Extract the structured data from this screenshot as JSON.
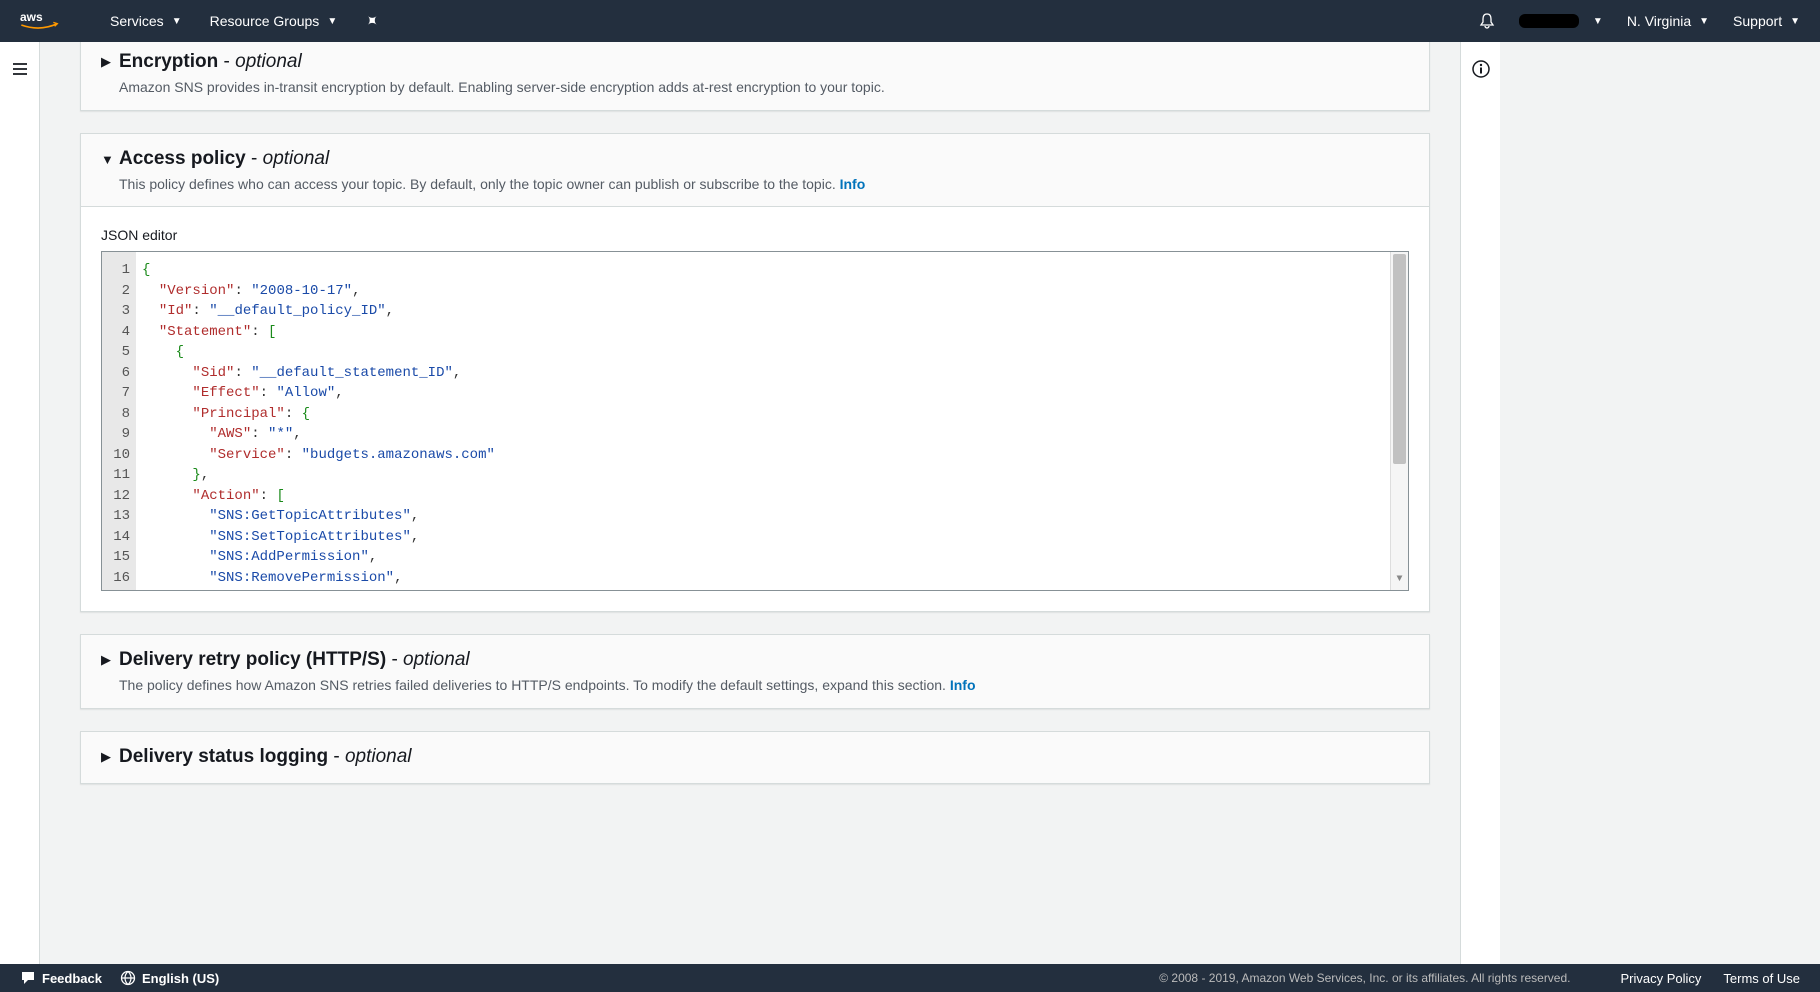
{
  "nav": {
    "services": "Services",
    "resource_groups": "Resource Groups",
    "region": "N. Virginia",
    "support": "Support"
  },
  "panels": {
    "encryption": {
      "title": "Encryption",
      "optional": "optional",
      "desc": "Amazon SNS provides in-transit encryption by default. Enabling server-side encryption adds at-rest encryption to your topic."
    },
    "access_policy": {
      "title": "Access policy",
      "optional": "optional",
      "desc_text": "This policy defines who can access your topic. By default, only the topic owner can publish or subscribe to the topic.",
      "info": "Info",
      "editor_label": "JSON editor"
    },
    "delivery_retry": {
      "title": "Delivery retry policy (HTTP/S)",
      "optional": "optional",
      "desc_text": "The policy defines how Amazon SNS retries failed deliveries to HTTP/S endpoints. To modify the default settings, expand this section.",
      "info": "Info"
    },
    "delivery_status": {
      "title": "Delivery status logging",
      "optional": "optional"
    }
  },
  "footer": {
    "feedback": "Feedback",
    "language": "English (US)",
    "copyright": "© 2008 - 2019, Amazon Web Services, Inc. or its affiliates. All rights reserved.",
    "privacy": "Privacy Policy",
    "terms": "Terms of Use"
  },
  "code": {
    "gutter": [
      "1",
      "2",
      "3",
      "4",
      "5",
      "6",
      "7",
      "8",
      "9",
      "10",
      "11",
      "12",
      "13",
      "14",
      "15",
      "16"
    ],
    "lines": [
      [
        {
          "t": "brace",
          "v": "{"
        }
      ],
      [
        {
          "t": "default",
          "v": "  "
        },
        {
          "t": "key",
          "v": "\"Version\""
        },
        {
          "t": "punc",
          "v": ": "
        },
        {
          "t": "str",
          "v": "\"2008-10-17\""
        },
        {
          "t": "punc",
          "v": ","
        }
      ],
      [
        {
          "t": "default",
          "v": "  "
        },
        {
          "t": "key",
          "v": "\"Id\""
        },
        {
          "t": "punc",
          "v": ": "
        },
        {
          "t": "str",
          "v": "\"__default_policy_ID\""
        },
        {
          "t": "punc",
          "v": ","
        }
      ],
      [
        {
          "t": "default",
          "v": "  "
        },
        {
          "t": "key",
          "v": "\"Statement\""
        },
        {
          "t": "punc",
          "v": ": "
        },
        {
          "t": "bracket",
          "v": "["
        }
      ],
      [
        {
          "t": "default",
          "v": "    "
        },
        {
          "t": "brace",
          "v": "{"
        }
      ],
      [
        {
          "t": "default",
          "v": "      "
        },
        {
          "t": "key",
          "v": "\"Sid\""
        },
        {
          "t": "punc",
          "v": ": "
        },
        {
          "t": "str",
          "v": "\"__default_statement_ID\""
        },
        {
          "t": "punc",
          "v": ","
        }
      ],
      [
        {
          "t": "default",
          "v": "      "
        },
        {
          "t": "key",
          "v": "\"Effect\""
        },
        {
          "t": "punc",
          "v": ": "
        },
        {
          "t": "str",
          "v": "\"Allow\""
        },
        {
          "t": "punc",
          "v": ","
        }
      ],
      [
        {
          "t": "default",
          "v": "      "
        },
        {
          "t": "key",
          "v": "\"Principal\""
        },
        {
          "t": "punc",
          "v": ": "
        },
        {
          "t": "brace",
          "v": "{"
        }
      ],
      [
        {
          "t": "default",
          "v": "        "
        },
        {
          "t": "key",
          "v": "\"AWS\""
        },
        {
          "t": "punc",
          "v": ": "
        },
        {
          "t": "str",
          "v": "\"*\""
        },
        {
          "t": "punc",
          "v": ","
        }
      ],
      [
        {
          "t": "default",
          "v": "        "
        },
        {
          "t": "key",
          "v": "\"Service\""
        },
        {
          "t": "punc",
          "v": ": "
        },
        {
          "t": "str",
          "v": "\"budgets.amazonaws.com\""
        }
      ],
      [
        {
          "t": "default",
          "v": "      "
        },
        {
          "t": "brace",
          "v": "}"
        },
        {
          "t": "punc",
          "v": ","
        }
      ],
      [
        {
          "t": "default",
          "v": "      "
        },
        {
          "t": "key",
          "v": "\"Action\""
        },
        {
          "t": "punc",
          "v": ": "
        },
        {
          "t": "bracket",
          "v": "["
        }
      ],
      [
        {
          "t": "default",
          "v": "        "
        },
        {
          "t": "str",
          "v": "\"SNS:GetTopicAttributes\""
        },
        {
          "t": "punc",
          "v": ","
        }
      ],
      [
        {
          "t": "default",
          "v": "        "
        },
        {
          "t": "str",
          "v": "\"SNS:SetTopicAttributes\""
        },
        {
          "t": "punc",
          "v": ","
        }
      ],
      [
        {
          "t": "default",
          "v": "        "
        },
        {
          "t": "str",
          "v": "\"SNS:AddPermission\""
        },
        {
          "t": "punc",
          "v": ","
        }
      ],
      [
        {
          "t": "default",
          "v": "        "
        },
        {
          "t": "str",
          "v": "\"SNS:RemovePermission\""
        },
        {
          "t": "punc",
          "v": ","
        }
      ]
    ]
  }
}
